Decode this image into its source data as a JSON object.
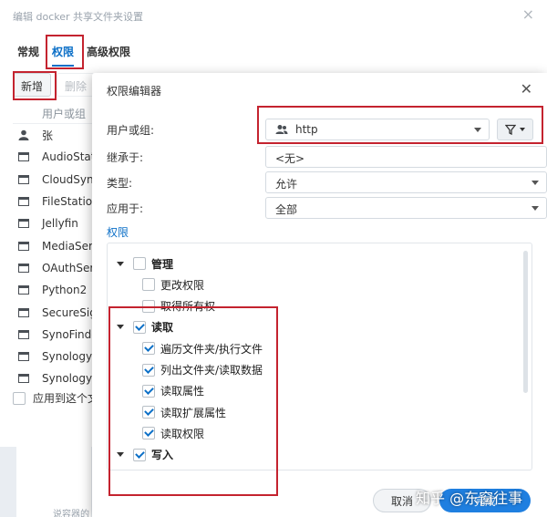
{
  "background_window": {
    "title": "编辑 docker 共享文件夹设置",
    "tabs": [
      "常规",
      "权限",
      "高级权限"
    ],
    "toolbar": {
      "add_label": "新增",
      "delete_label": "删除"
    },
    "list_header": "用户或组",
    "rows": [
      {
        "icon": "user-icon",
        "name": "张"
      },
      {
        "icon": "app-window-icon",
        "name": "AudioStat"
      },
      {
        "icon": "app-window-icon",
        "name": "CloudSync"
      },
      {
        "icon": "app-window-icon",
        "name": "FileStation"
      },
      {
        "icon": "app-window-icon",
        "name": "Jellyfin"
      },
      {
        "icon": "app-window-icon",
        "name": "MediaServ"
      },
      {
        "icon": "app-window-icon",
        "name": "OAuthServ"
      },
      {
        "icon": "app-window-icon",
        "name": "Python2"
      },
      {
        "icon": "app-window-icon",
        "name": "SecureSig"
      },
      {
        "icon": "app-window-icon",
        "name": "SynoFinde"
      },
      {
        "icon": "app-window-icon",
        "name": "SynologyA"
      },
      {
        "icon": "app-window-icon",
        "name": "SynologyF"
      }
    ],
    "apply_label": "应用到这个文",
    "footer_text": "说容器的"
  },
  "dialog": {
    "title": "权限编辑器",
    "user_group_label": "用户或组:",
    "user_group_value": "http",
    "inherit_label": "继承于:",
    "inherit_value": "<无>",
    "type_label": "类型:",
    "type_value": "允许",
    "apply_to_label": "应用于:",
    "apply_to_value": "全部",
    "permissions_title": "权限",
    "tree": [
      {
        "level": 0,
        "label": "管理",
        "checked": false,
        "expanded": true
      },
      {
        "level": 1,
        "label": "更改权限",
        "checked": false
      },
      {
        "level": 1,
        "label": "取得所有权",
        "checked": false
      },
      {
        "level": 0,
        "label": "读取",
        "checked": true,
        "expanded": true
      },
      {
        "level": 1,
        "label": "遍历文件夹/执行文件",
        "checked": true
      },
      {
        "level": 1,
        "label": "列出文件夹/读取数据",
        "checked": true
      },
      {
        "level": 1,
        "label": "读取属性",
        "checked": true
      },
      {
        "level": 1,
        "label": "读取扩展属性",
        "checked": true
      },
      {
        "level": 1,
        "label": "读取权限",
        "checked": true
      },
      {
        "level": 0,
        "label": "写入",
        "checked": true,
        "expanded": true
      }
    ],
    "cancel_label": "取消",
    "ok_label": "完成"
  },
  "watermark": "知乎 @东窗往事",
  "colors": {
    "accent": "#0b6fc7",
    "highlight": "#c4232f",
    "primary_button": "#1f7fe0"
  }
}
